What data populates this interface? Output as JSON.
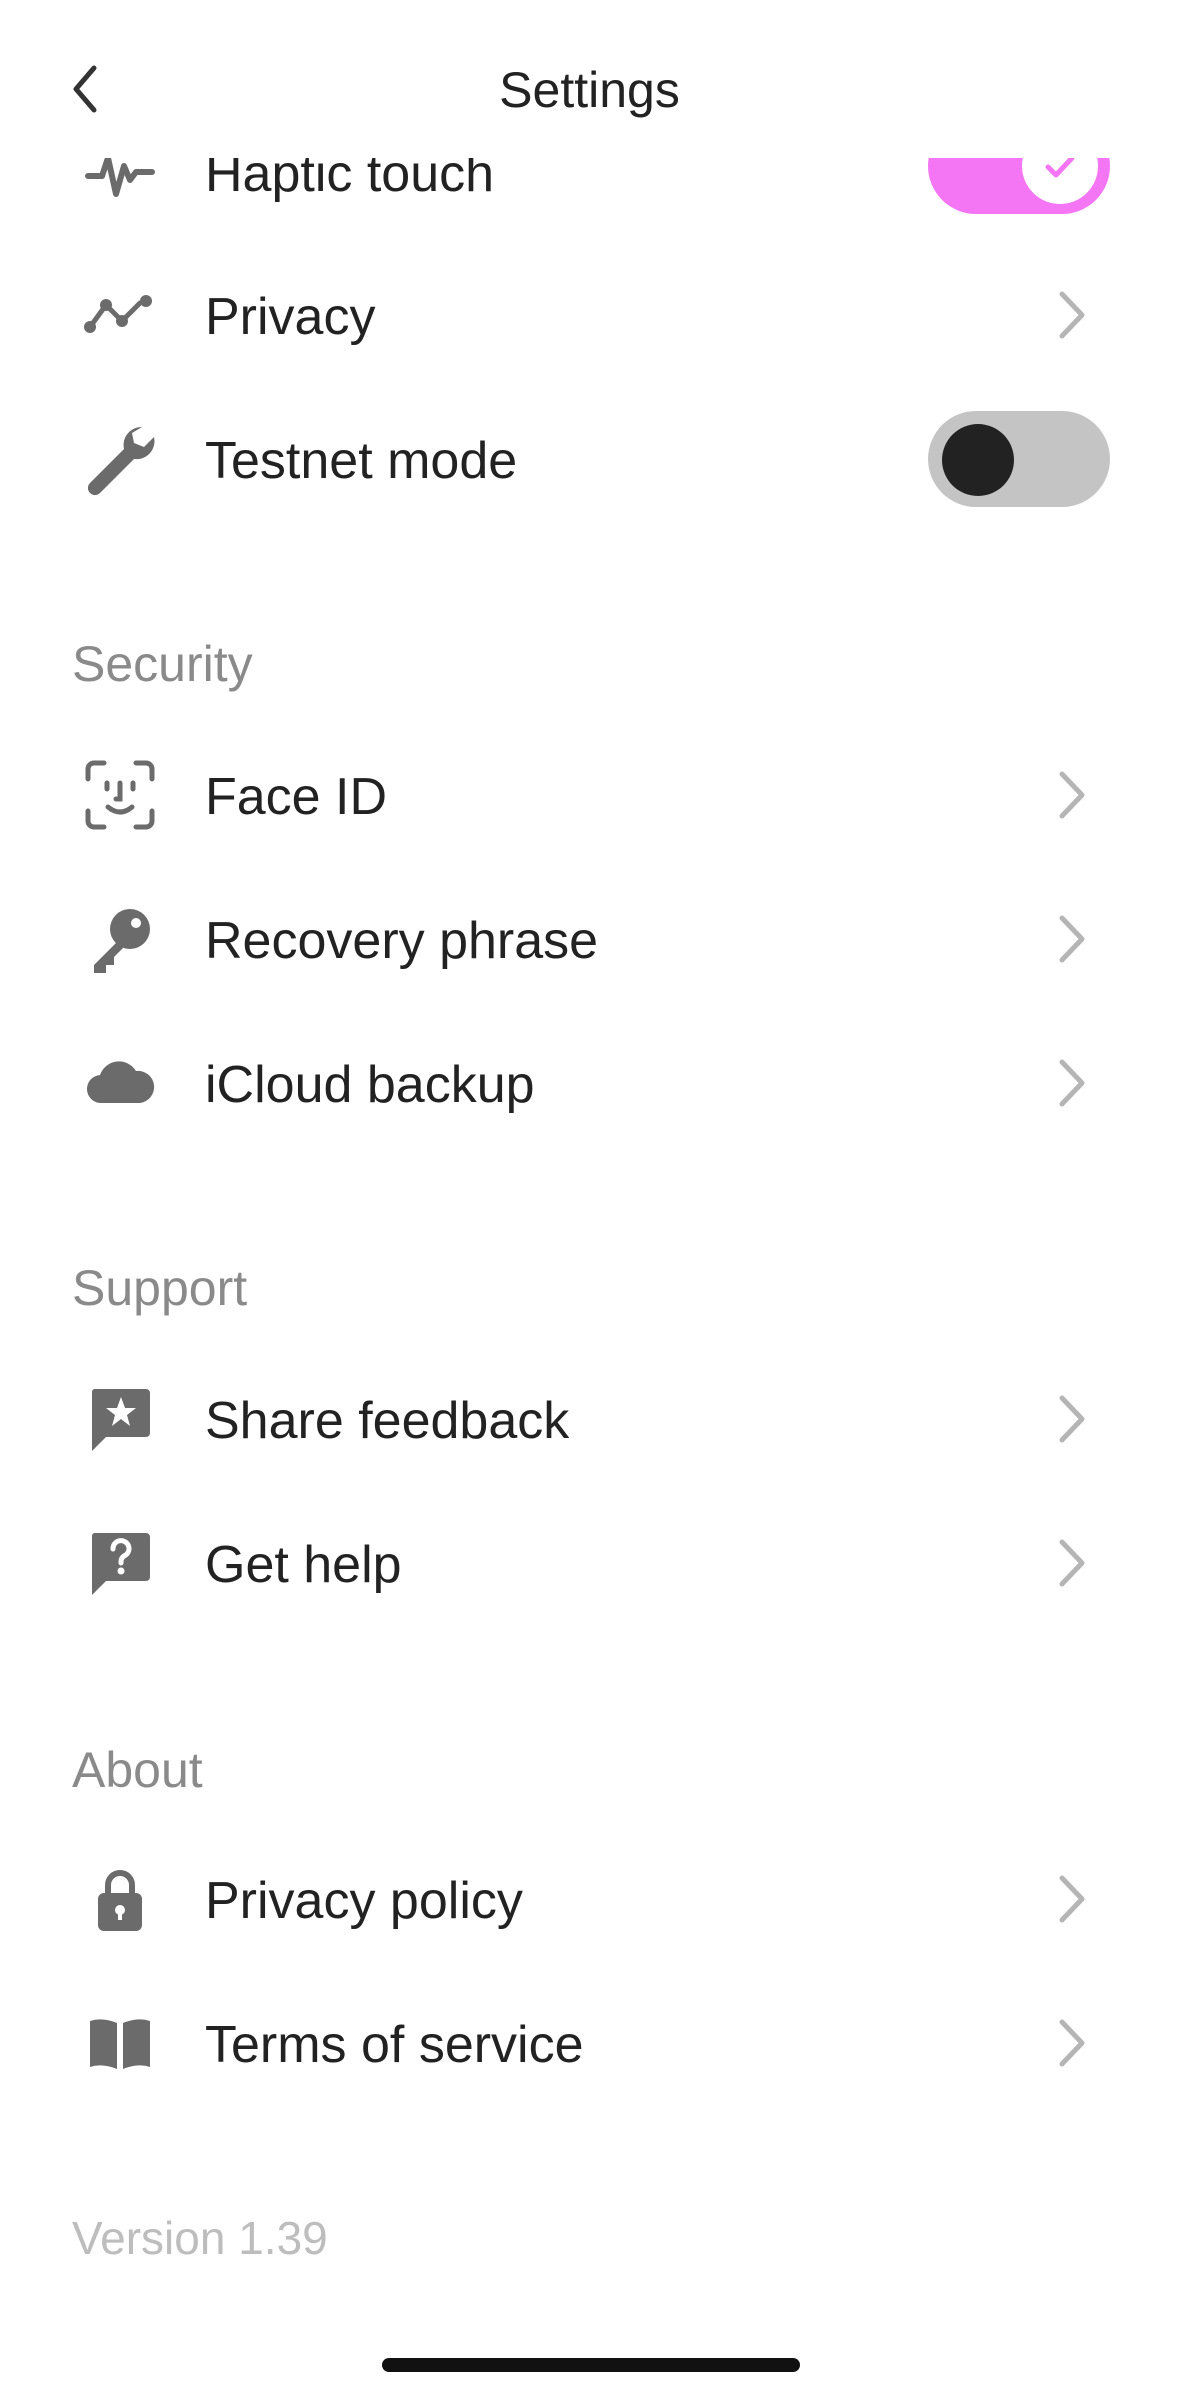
{
  "header": {
    "title": "Settings",
    "back_icon": "chevron-left-icon"
  },
  "general": {
    "items": [
      {
        "label": "Haptic touch",
        "icon": "waveform-icon",
        "control": "toggle",
        "state": "on"
      },
      {
        "label": "Privacy",
        "icon": "activity-line-icon",
        "control": "chevron"
      },
      {
        "label": "Testnet mode",
        "icon": "wrench-icon",
        "control": "toggle",
        "state": "off"
      }
    ]
  },
  "security": {
    "title": "Security",
    "items": [
      {
        "label": "Face ID",
        "icon": "face-id-icon"
      },
      {
        "label": "Recovery phrase",
        "icon": "key-icon"
      },
      {
        "label": "iCloud backup",
        "icon": "cloud-icon"
      }
    ]
  },
  "support": {
    "title": "Support",
    "items": [
      {
        "label": "Share feedback",
        "icon": "star-message-icon"
      },
      {
        "label": "Get help",
        "icon": "question-message-icon"
      }
    ]
  },
  "about": {
    "title": "About",
    "items": [
      {
        "label": "Privacy policy",
        "icon": "lock-icon"
      },
      {
        "label": "Terms of service",
        "icon": "book-icon"
      }
    ]
  },
  "footer": {
    "version": "Version 1.39"
  },
  "colors": {
    "toggle_on": "#f576f5",
    "toggle_off": "#c4c4c4",
    "icon": "#6b6b6b",
    "section_title": "#8a8a8a",
    "version": "#bdbdbd"
  }
}
